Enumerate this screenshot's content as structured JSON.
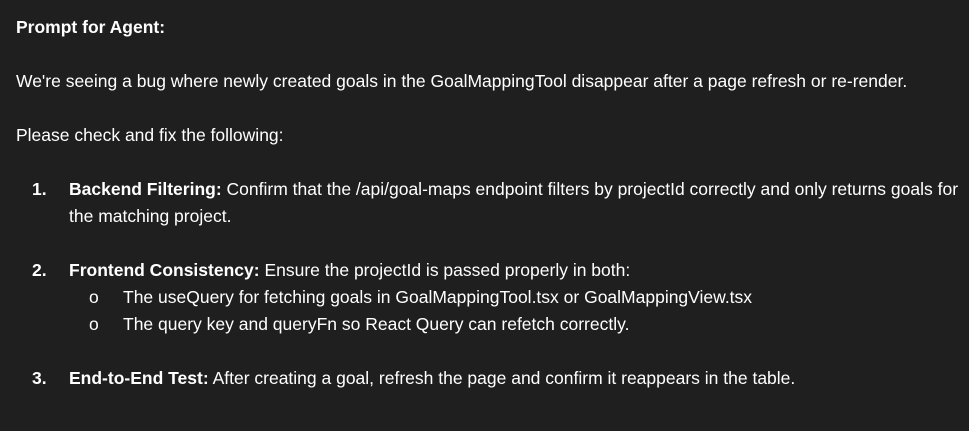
{
  "heading": "Prompt for Agent:",
  "intro": "We're seeing a bug where newly created goals in the GoalMappingTool disappear after a page refresh or re-render.",
  "check_line": "Please check and fix the following:",
  "steps": [
    {
      "number": "1.",
      "title": "Backend Filtering:",
      "text": "Confirm that the /api/goal-maps endpoint filters by projectId correctly and only returns goals for the matching project."
    },
    {
      "number": "2.",
      "title": "Frontend Consistency:",
      "text": "Ensure the projectId is passed properly in both:",
      "sub_bullet": "o",
      "sub_items": [
        "The useQuery for fetching goals in GoalMappingTool.tsx or GoalMappingView.tsx",
        "The query key and queryFn so React Query can refetch correctly."
      ]
    },
    {
      "number": "3.",
      "title": "End-to-End Test:",
      "text": "After creating a goal, refresh the page and confirm it reappears in the table."
    }
  ]
}
